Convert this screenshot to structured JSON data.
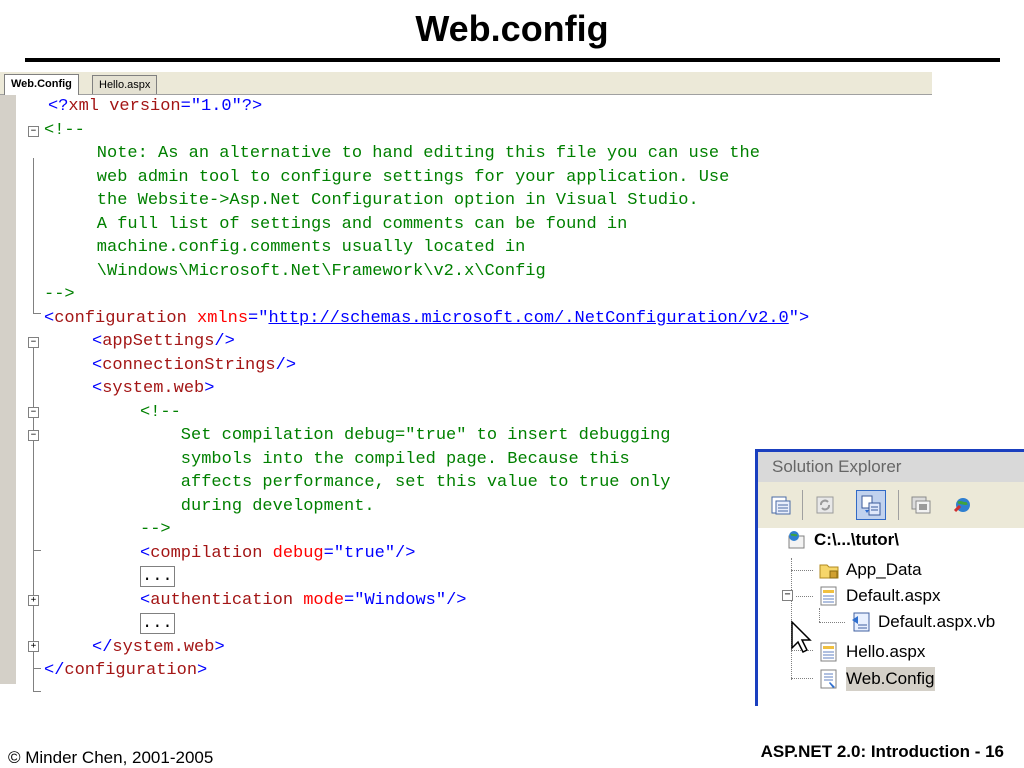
{
  "slide": {
    "title": "Web.config",
    "footer_left": "© Minder Chen, 2001-2005",
    "footer_right": "ASP.NET 2.0: Introduction  - 16"
  },
  "editor": {
    "tabs": [
      {
        "label": "Web.Config",
        "active": true
      },
      {
        "label": "Hello.aspx",
        "active": false
      }
    ],
    "lines": {
      "l1": {
        "a": "<?",
        "b": "xml version",
        "c": "=\"",
        "d": "1.0",
        "e": "\"?>"
      },
      "l2": "<!--",
      "l3": "    Note: As an alternative to hand editing this file you can use the",
      "l4": "    web admin tool to configure settings for your application. Use",
      "l5": "    the Website->Asp.Net Configuration option in Visual Studio.",
      "l6": "    A full list of settings and comments can be found in",
      "l7": "    machine.config.comments usually located in",
      "l8": "    \\Windows\\Microsoft.Net\\Framework\\v2.x\\Config",
      "l9": "-->",
      "l10": {
        "a": "<",
        "b": "configuration",
        "c": " xmlns",
        "d": "=\"",
        "e": "http://schemas.microsoft.com/.NetConfiguration/v2.0",
        "f": "\">"
      },
      "l11": {
        "a": "<",
        "b": "appSettings",
        "c": "/>"
      },
      "l12": {
        "a": "<",
        "b": "connectionStrings",
        "c": "/>"
      },
      "l13": {
        "a": "<",
        "b": "system.web",
        "c": ">"
      },
      "l14": "<!--",
      "l15": "    Set compilation debug=\"true\" to insert debugging",
      "l16": "    symbols into the compiled page. Because this",
      "l17": "    affects performance, set this value to true only",
      "l18": "    during development.",
      "l19": "-->",
      "l20": {
        "a": "<",
        "b": "compilation",
        "c": " debug",
        "d": "=\"",
        "e": "true",
        "f": "\"/>"
      },
      "l21": "...",
      "l22": {
        "a": "<",
        "b": "authentication",
        "c": " mode",
        "d": "=\"",
        "e": "Windows",
        "f": "\"/>"
      },
      "l23": "...",
      "l24": {
        "a": "</",
        "b": "system.web",
        "c": ">"
      },
      "l25": {
        "a": "</",
        "b": "configuration",
        "c": ">"
      }
    }
  },
  "solution_explorer": {
    "title": "Solution Explorer",
    "tree": {
      "root": "C:\\...\\tutor\\",
      "app_data": "App_Data",
      "default_aspx": "Default.aspx",
      "default_vb": "Default.aspx.vb",
      "hello": "Hello.aspx",
      "webconfig": "Web.Config"
    },
    "toolbar_icons": [
      "properties-icon",
      "refresh-icon",
      "nest-related-files-icon",
      "view-designer-icon",
      "copy-web-site-icon"
    ]
  },
  "colors": {
    "comment": "#008000",
    "tag": "#a31515",
    "attribute": "#ff0000",
    "value": "#0000ff",
    "se_border": "#1a3fbf"
  }
}
